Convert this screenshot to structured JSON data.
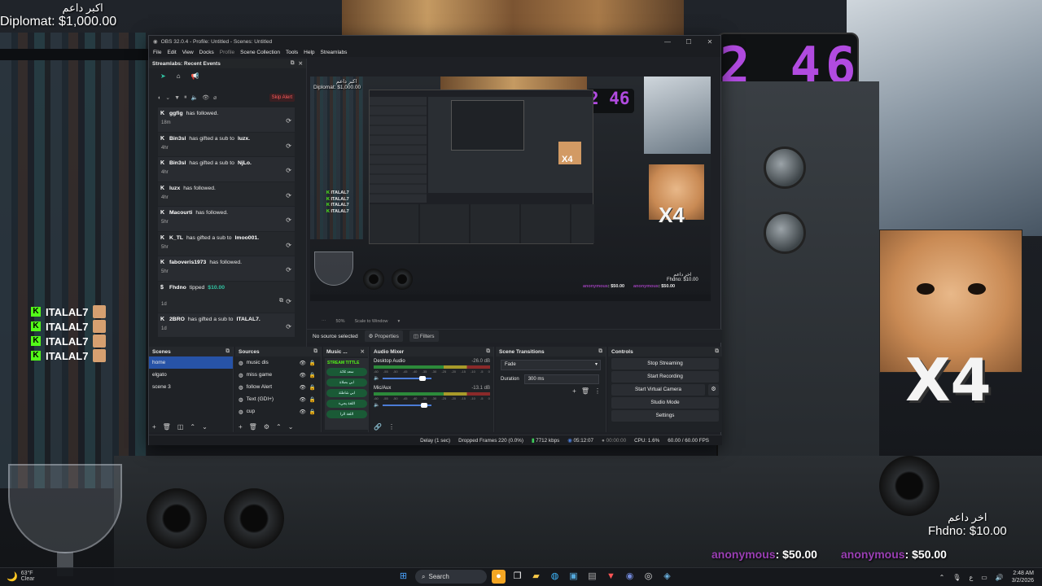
{
  "stream_overlay": {
    "top_alert": {
      "arabic": "اكبر داعم",
      "text": "Diplomat: $1,000.00"
    },
    "clock": "2 46",
    "cat_overlay_label": "X4",
    "chat": [
      {
        "badge": "K",
        "name": "ITALAL7"
      },
      {
        "badge": "K",
        "name": "ITALAL7"
      },
      {
        "badge": "K",
        "name": "ITALAL7"
      },
      {
        "badge": "K",
        "name": "ITALAL7"
      }
    ],
    "bottom_alert": {
      "arabic": "اخر داعم",
      "text": "Fhdno: $10.00"
    },
    "tips": [
      {
        "name": "anonymous",
        "amount": ": $50.00"
      },
      {
        "name": "anonymous",
        "amount": ": $50.00"
      }
    ]
  },
  "obs": {
    "title": "OBS 32.0.4 - Profile: Untitled - Scenes: Untitled",
    "menu": [
      "File",
      "Edit",
      "View",
      "Docks",
      "Profile",
      "Scene Collection",
      "Tools",
      "Help",
      "Streamlabs"
    ],
    "events": {
      "title": "Streamlabs: Recent Events",
      "skip_label": "Skip Alert",
      "items": [
        {
          "name": "ggfig",
          "text": "has followed.",
          "time": "18m"
        },
        {
          "name": "Bin3sl",
          "text": "has gifted a sub to",
          "target": "luzx.",
          "time": "4hr"
        },
        {
          "name": "Bin3sl",
          "text": "has gifted a sub to",
          "target": "NjLo.",
          "time": "4hr"
        },
        {
          "name": "luzx",
          "text": "has followed.",
          "time": "4hr"
        },
        {
          "name": "Macourti",
          "text": "has followed.",
          "time": "5hr"
        },
        {
          "name": "K_TL",
          "text": "has gifted a sub to",
          "target": "lmoo001.",
          "time": "5hr"
        },
        {
          "name": "faboveris1973",
          "text": "has followed.",
          "time": "5hr"
        },
        {
          "name": "Fhdno",
          "text": "tipped",
          "target": "$10.00",
          "time": "1d"
        },
        {
          "name": "2BRO",
          "text": "has gifted a sub to",
          "target": "ITALAL7.",
          "time": "1d"
        }
      ]
    },
    "preview": {
      "alert_arabic": "اكبر داعم",
      "alert_text": "Diplomat: $1,000.00",
      "clock": "2 46",
      "x4": "X4",
      "chat": [
        "ITALAL7",
        "ITALAL7",
        "ITALAL7",
        "ITALAL7"
      ],
      "fhdno_arabic": "اخر داعم",
      "fhdno": "Fhdno: $10.00",
      "tip_name": "anonymous",
      "tip_amount": ": $50.00"
    },
    "zoom": {
      "percent": "50%",
      "mode": "Scale to Window"
    },
    "source_bar": {
      "status": "No source selected",
      "properties": "Properties",
      "filters": "Filters"
    },
    "scenes": {
      "title": "Scenes",
      "items": [
        "home",
        "elgato",
        "scene 3"
      ]
    },
    "sources": {
      "title": "Sources",
      "items": [
        "music dis",
        "miss game",
        "follow Alert",
        "Text (GDI+)",
        "cup"
      ]
    },
    "music": {
      "title": "Music ...",
      "stream_title": "STREAM TITTLE",
      "lines": [
        "سعد ثلاثة",
        "ابي بصلاة",
        "ابي شاطئة",
        "اللغة يجيء",
        "اللغة الرا"
      ]
    },
    "mixer": {
      "title": "Audio Mixer",
      "channels": [
        {
          "name": "Desktop Audio",
          "db": "-26.0 dB",
          "volume": 0.85
        },
        {
          "name": "Mic/Aux",
          "db": "-13.1 dB",
          "volume": 0.9
        }
      ],
      "scale": [
        "-60",
        "-55",
        "-50",
        "-45",
        "-40",
        "-35",
        "-30",
        "-25",
        "-20",
        "-15",
        "-10",
        "-5",
        "0"
      ]
    },
    "transitions": {
      "title": "Scene Transitions",
      "selected": "Fade",
      "duration_label": "Duration",
      "duration_value": "300 ms"
    },
    "controls": {
      "title": "Controls",
      "buttons": [
        "Stop Streaming",
        "Start Recording",
        "Start Virtual Camera",
        "Studio Mode",
        "Settings"
      ]
    },
    "status": {
      "delay": "Delay (1 sec)",
      "dropped": "Dropped Frames 220 (0.0%)",
      "kbps": "7712 kbps",
      "stream_time": "05:12:07",
      "rec_time": "00:00:00",
      "cpu": "CPU: 1.6%",
      "fps": "60.00 / 60.00 FPS"
    }
  },
  "taskbar": {
    "weather_temp": "63°F",
    "weather_desc": "Clear",
    "search_label": "Search",
    "time": "2:48 AM",
    "date": "3/2/2026"
  }
}
